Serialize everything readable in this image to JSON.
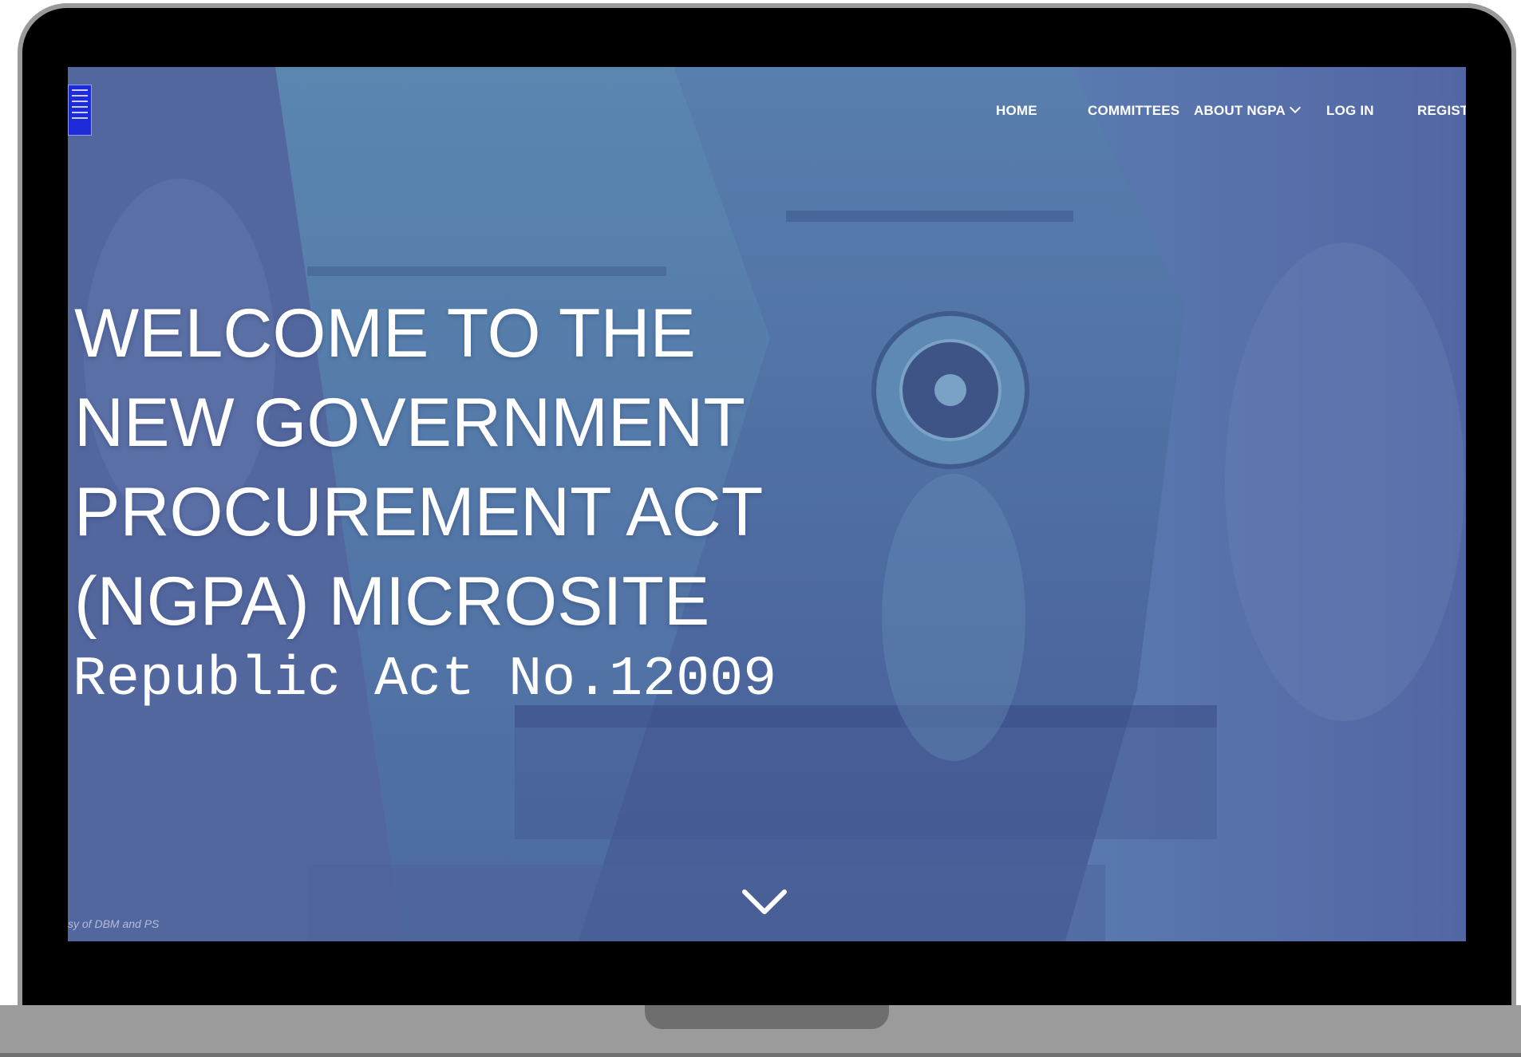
{
  "header": {
    "logo_icon": "ngpa-logo",
    "nav": {
      "home": "HOME",
      "committees": "COMMITTEES",
      "about": "ABOUT NGPA",
      "login": "LOG IN",
      "register": "REGIST"
    }
  },
  "hero": {
    "title_lines": [
      "WELCOME TO THE",
      "NEW GOVERNMENT",
      "PROCUREMENT ACT",
      "(NGPA) MICROSITE"
    ],
    "subtitle": "Republic Act No.12009",
    "photo_credit": "sy of DBM and PS",
    "scroll_icon": "chevron-down-icon"
  },
  "colors": {
    "overlay": "#4a5a96",
    "device_frame": "#9b9b9b",
    "text": "#ffffff"
  }
}
